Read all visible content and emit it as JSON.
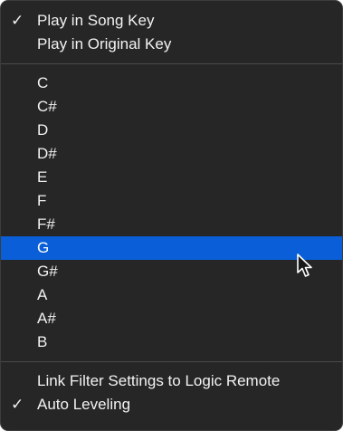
{
  "menu": {
    "key_mode_items": [
      {
        "label": "Play in Song Key",
        "checked": true
      },
      {
        "label": "Play in Original Key",
        "checked": false
      }
    ],
    "key_items": [
      {
        "label": "C",
        "selected": false
      },
      {
        "label": "C#",
        "selected": false
      },
      {
        "label": "D",
        "selected": false
      },
      {
        "label": "D#",
        "selected": false
      },
      {
        "label": "E",
        "selected": false
      },
      {
        "label": "F",
        "selected": false
      },
      {
        "label": "F#",
        "selected": false
      },
      {
        "label": "G",
        "selected": true
      },
      {
        "label": "G#",
        "selected": false
      },
      {
        "label": "A",
        "selected": false
      },
      {
        "label": "A#",
        "selected": false
      },
      {
        "label": "B",
        "selected": false
      }
    ],
    "option_items": [
      {
        "label": "Link Filter Settings to Logic Remote",
        "checked": false
      },
      {
        "label": "Auto Leveling",
        "checked": true
      }
    ],
    "check_glyph": "✓"
  },
  "colors": {
    "menu_background": "#262626",
    "highlight": "#0a5fd8",
    "text": "#f2f2f2",
    "separator": "#4a4a4a"
  },
  "pointer": {
    "icon": "arrow-cursor-icon"
  }
}
